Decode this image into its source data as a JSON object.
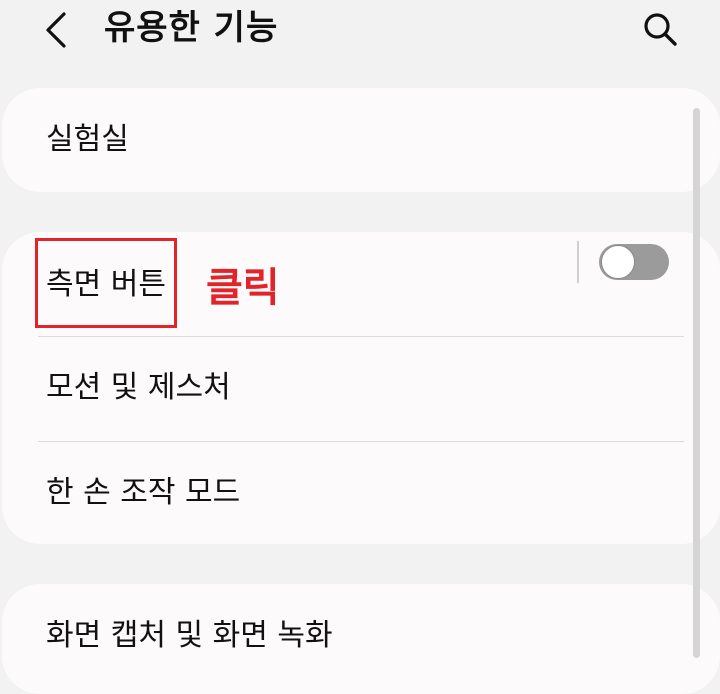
{
  "header": {
    "title": "유용한 기능",
    "back_icon": "chevron-left-icon",
    "search_icon": "search-icon"
  },
  "sections": [
    {
      "items": [
        {
          "label": "실험실"
        }
      ]
    },
    {
      "items": [
        {
          "label": "측면 버튼"
        },
        {
          "label": "모션 및 제스처"
        },
        {
          "label": "한 손 조작 모드",
          "toggle": false
        }
      ]
    },
    {
      "items": [
        {
          "label": "화면 캡처 및 화면 녹화"
        }
      ]
    }
  ],
  "annotation": {
    "text": "클릭",
    "color": "#e0242a"
  }
}
